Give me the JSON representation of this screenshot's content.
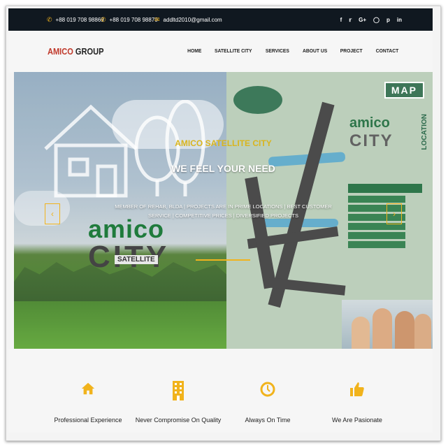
{
  "topbar": {
    "phone1": "+88 019 708 98869",
    "phone2": "+88 019 708 98870",
    "email": "addltd2010@gmail.com",
    "social": [
      "f",
      "t",
      "G+",
      "ig",
      "p",
      "in"
    ]
  },
  "header": {
    "logo_part1": "AMICO",
    "logo_part2": "GROUP",
    "nav": [
      "HOME",
      "SATELLITE CITY",
      "SERVICES",
      "ABOUT US",
      "PROJECT",
      "CONTACT"
    ]
  },
  "hero": {
    "title": "AMICO SATELLITE CITY",
    "subtitle": "WE FEEL YOUR NEED",
    "description": "MEMBER OF REHAB, BLDA | PROJECTS ARE IN PRIME LOCATIONS | BEST CUSTOMER SERVICE | COMPETITIVE PRICES | DIVERSIFIED PROJECTS",
    "prev": "‹",
    "next": "›",
    "brand_word1": "amico",
    "brand_word2": "CITY",
    "brand_word3": "SATELLITE",
    "map_badge": "MAP",
    "map_location": "LOCATION",
    "map_logo1": "amico",
    "map_logo2": "CITY"
  },
  "features": [
    {
      "label": "Professional Experience",
      "icon": "home-icon"
    },
    {
      "label": "Never Compromise On Quality",
      "icon": "building-icon"
    },
    {
      "label": "Always On Time",
      "icon": "clock-icon"
    },
    {
      "label": "We Are Pasionate",
      "icon": "thumbs-up-icon"
    }
  ],
  "colors": {
    "accent": "#f1b31c",
    "topbar": "#101820",
    "brand_red": "#c0392b",
    "brand_green": "#1f7b3c"
  }
}
